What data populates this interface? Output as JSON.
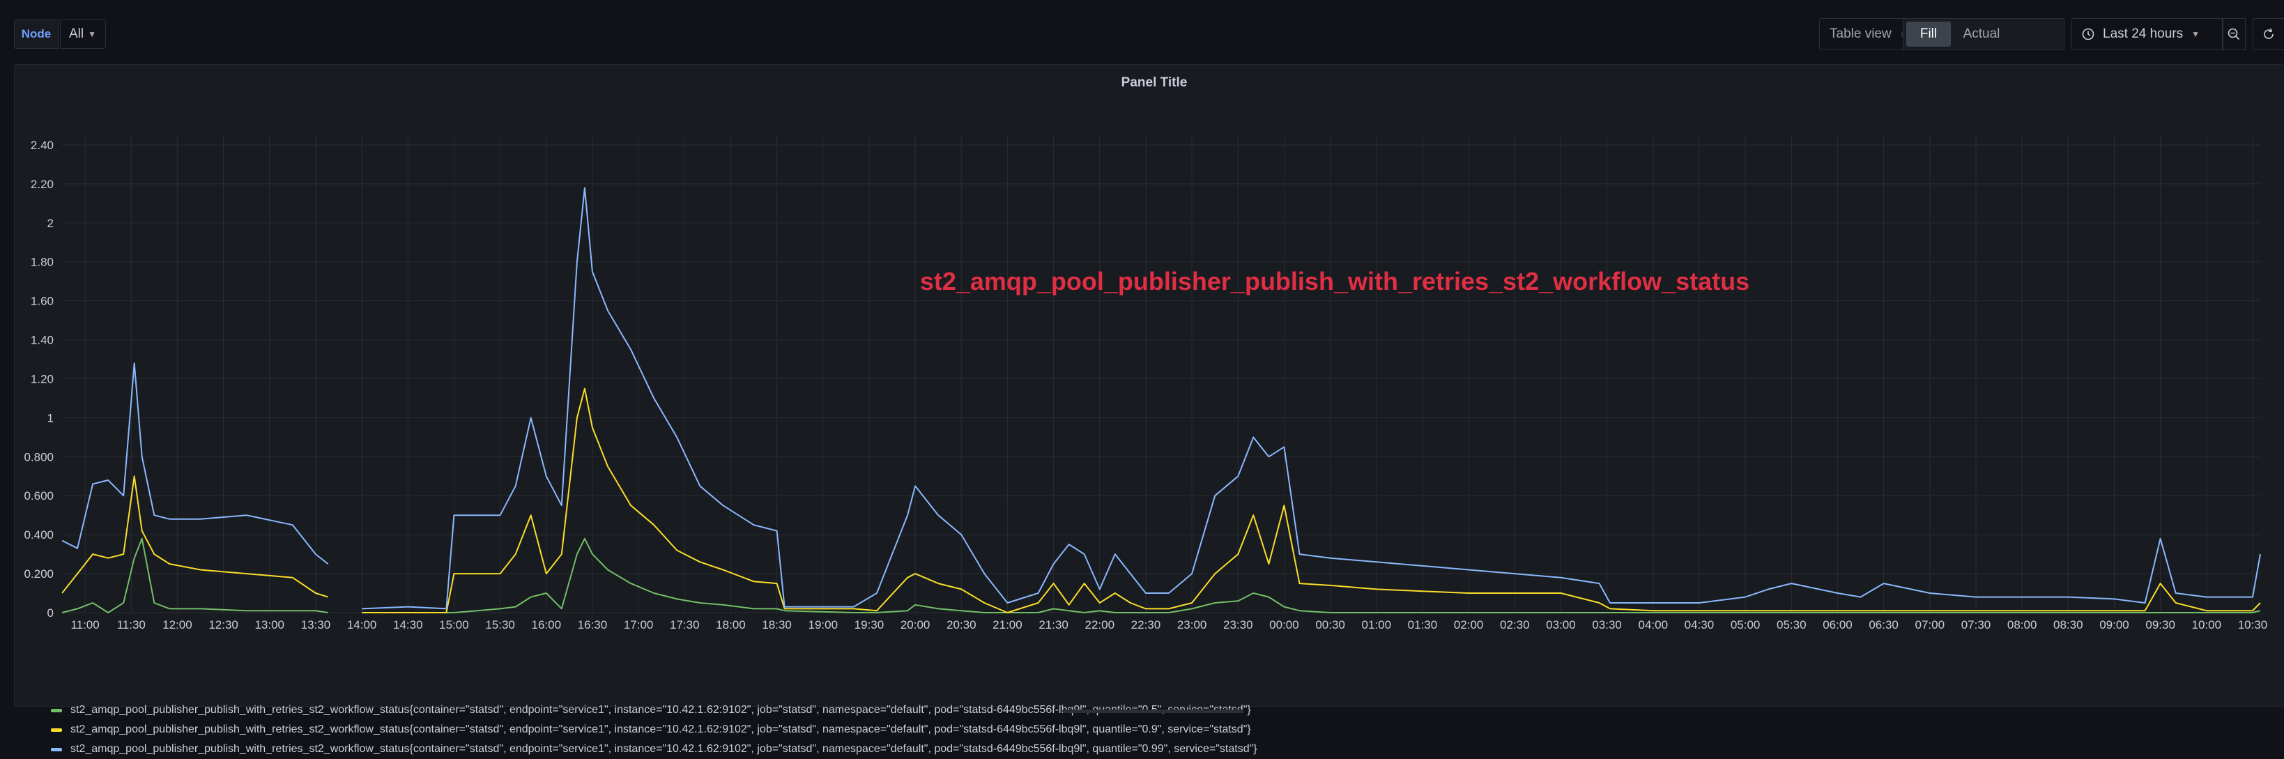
{
  "toolbar": {
    "variable_label": "Node",
    "variable_value": "All",
    "table_view_label": "Table view",
    "fill_label": "Fill",
    "actual_label": "Actual",
    "time_range": "Last 24 hours"
  },
  "panel": {
    "title": "Panel Title",
    "annotation": "st2_amqp_pool_publisher_publish_with_retries_st2_workflow_status"
  },
  "colors": {
    "q05": "#73bf69",
    "q09": "#fade2a",
    "q099": "#8ab8ff",
    "grid": "#2a2d33",
    "annotation": "#e02f44"
  },
  "chart_data": {
    "type": "line",
    "title": "",
    "xlabel": "",
    "ylabel": "",
    "ylim": [
      0,
      2.45
    ],
    "xlim": [
      "10:45",
      "10:35"
    ],
    "yticks": [
      "0",
      "0.200",
      "0.400",
      "0.600",
      "0.800",
      "1",
      "1.20",
      "1.40",
      "1.60",
      "1.80",
      "2",
      "2.20",
      "2.40"
    ],
    "xticks": [
      "11:00",
      "11:30",
      "12:00",
      "12:30",
      "13:00",
      "13:30",
      "14:00",
      "14:30",
      "15:00",
      "15:30",
      "16:00",
      "16:30",
      "17:00",
      "17:30",
      "18:00",
      "18:30",
      "19:00",
      "19:30",
      "20:00",
      "20:30",
      "21:00",
      "21:30",
      "22:00",
      "22:30",
      "23:00",
      "23:30",
      "00:00",
      "00:30",
      "01:00",
      "01:30",
      "02:00",
      "02:30",
      "03:00",
      "03:30",
      "04:00",
      "04:30",
      "05:00",
      "05:30",
      "06:00",
      "06:30",
      "07:00",
      "07:30",
      "08:00",
      "08:30",
      "09:00",
      "09:30",
      "10:00",
      "10:30"
    ],
    "grid": true,
    "legend_position": "bottom",
    "x": [
      "10:45",
      "10:55",
      "11:05",
      "11:15",
      "11:25",
      "11:32",
      "11:37",
      "11:45",
      "11:55",
      "12:15",
      "12:45",
      "13:15",
      "13:30",
      "13:38",
      "13:40",
      "14:00",
      "14:30",
      "14:55",
      "15:00",
      "15:15",
      "15:30",
      "15:40",
      "15:50",
      "16:00",
      "16:10",
      "16:20",
      "16:25",
      "16:30",
      "16:40",
      "16:55",
      "17:10",
      "17:25",
      "17:40",
      "17:55",
      "18:15",
      "18:30",
      "18:35",
      "19:20",
      "19:35",
      "19:55",
      "20:00",
      "20:15",
      "20:30",
      "20:45",
      "21:00",
      "21:20",
      "21:30",
      "21:40",
      "21:50",
      "22:00",
      "22:10",
      "22:20",
      "22:30",
      "22:45",
      "23:00",
      "23:15",
      "23:30",
      "23:40",
      "23:50",
      "00:00",
      "00:10",
      "00:30",
      "01:00",
      "01:30",
      "02:00",
      "02:30",
      "03:00",
      "03:25",
      "03:32",
      "04:00",
      "04:30",
      "05:00",
      "05:15",
      "05:30",
      "06:00",
      "06:15",
      "06:30",
      "07:00",
      "07:30",
      "08:00",
      "08:30",
      "09:00",
      "09:20",
      "09:30",
      "09:40",
      "10:00",
      "10:30",
      "10:35"
    ],
    "series": [
      {
        "name": "st2_amqp_pool_publisher_publish_with_retries_st2_workflow_status{container=\"statsd\", endpoint=\"service1\", instance=\"10.42.1.62:9102\", job=\"statsd\", namespace=\"default\", pod=\"statsd-6449bc556f-lbq9l\", quantile=\"0.5\", service=\"statsd\"}",
        "color_key": "q05",
        "values": [
          0.0,
          0.02,
          0.05,
          0.0,
          0.05,
          0.28,
          0.38,
          0.05,
          0.02,
          0.02,
          0.01,
          0.01,
          0.01,
          0.0,
          null,
          0.0,
          0.0,
          0.0,
          0.0,
          0.01,
          0.02,
          0.03,
          0.08,
          0.1,
          0.02,
          0.3,
          0.38,
          0.3,
          0.22,
          0.15,
          0.1,
          0.07,
          0.05,
          0.04,
          0.02,
          0.02,
          0.01,
          0.0,
          0.0,
          0.01,
          0.04,
          0.02,
          0.01,
          0.0,
          0.0,
          0.0,
          0.02,
          0.01,
          0.0,
          0.01,
          0.0,
          0.0,
          0.0,
          0.0,
          0.02,
          0.05,
          0.06,
          0.1,
          0.08,
          0.03,
          0.01,
          0.0,
          0.0,
          0.0,
          0.0,
          0.0,
          0.0,
          0.0,
          0.0,
          0.0,
          0.0,
          0.0,
          0.0,
          0.0,
          0.0,
          0.0,
          0.0,
          0.0,
          0.0,
          0.0,
          0.0,
          0.0,
          0.0,
          0.0,
          0.0,
          0.0,
          0.0,
          0.01
        ]
      },
      {
        "name": "st2_amqp_pool_publisher_publish_with_retries_st2_workflow_status{container=\"statsd\", endpoint=\"service1\", instance=\"10.42.1.62:9102\", job=\"statsd\", namespace=\"default\", pod=\"statsd-6449bc556f-lbq9l\", quantile=\"0.9\", service=\"statsd\"}",
        "color_key": "q09",
        "values": [
          0.1,
          0.2,
          0.3,
          0.28,
          0.3,
          0.7,
          0.42,
          0.3,
          0.25,
          0.22,
          0.2,
          0.18,
          0.1,
          0.08,
          null,
          0.0,
          0.0,
          0.0,
          0.2,
          0.2,
          0.2,
          0.3,
          0.5,
          0.2,
          0.3,
          1.0,
          1.15,
          0.95,
          0.75,
          0.55,
          0.45,
          0.32,
          0.26,
          0.22,
          0.16,
          0.15,
          0.02,
          0.02,
          0.01,
          0.18,
          0.2,
          0.15,
          0.12,
          0.05,
          0.0,
          0.05,
          0.15,
          0.04,
          0.15,
          0.05,
          0.1,
          0.05,
          0.02,
          0.02,
          0.05,
          0.2,
          0.3,
          0.5,
          0.25,
          0.55,
          0.15,
          0.14,
          0.12,
          0.11,
          0.1,
          0.1,
          0.1,
          0.05,
          0.02,
          0.01,
          0.01,
          0.01,
          0.01,
          0.01,
          0.01,
          0.01,
          0.01,
          0.01,
          0.01,
          0.01,
          0.01,
          0.01,
          0.01,
          0.15,
          0.05,
          0.01,
          0.01,
          0.05
        ]
      },
      {
        "name": "st2_amqp_pool_publisher_publish_with_retries_st2_workflow_status{container=\"statsd\", endpoint=\"service1\", instance=\"10.42.1.62:9102\", job=\"statsd\", namespace=\"default\", pod=\"statsd-6449bc556f-lbq9l\", quantile=\"0.99\", service=\"statsd\"}",
        "color_key": "q099",
        "values": [
          0.37,
          0.33,
          0.66,
          0.68,
          0.6,
          1.28,
          0.8,
          0.5,
          0.48,
          0.48,
          0.5,
          0.45,
          0.3,
          0.25,
          null,
          0.02,
          0.03,
          0.02,
          0.5,
          0.5,
          0.5,
          0.65,
          1.0,
          0.7,
          0.55,
          1.8,
          2.18,
          1.75,
          1.55,
          1.35,
          1.1,
          0.9,
          0.65,
          0.55,
          0.45,
          0.42,
          0.03,
          0.03,
          0.1,
          0.5,
          0.65,
          0.5,
          0.4,
          0.2,
          0.05,
          0.1,
          0.25,
          0.35,
          0.3,
          0.12,
          0.3,
          0.2,
          0.1,
          0.1,
          0.2,
          0.6,
          0.7,
          0.9,
          0.8,
          0.85,
          0.3,
          0.28,
          0.26,
          0.24,
          0.22,
          0.2,
          0.18,
          0.15,
          0.05,
          0.05,
          0.05,
          0.08,
          0.12,
          0.15,
          0.1,
          0.08,
          0.15,
          0.1,
          0.08,
          0.08,
          0.08,
          0.07,
          0.05,
          0.38,
          0.1,
          0.08,
          0.08,
          0.3
        ]
      }
    ]
  }
}
